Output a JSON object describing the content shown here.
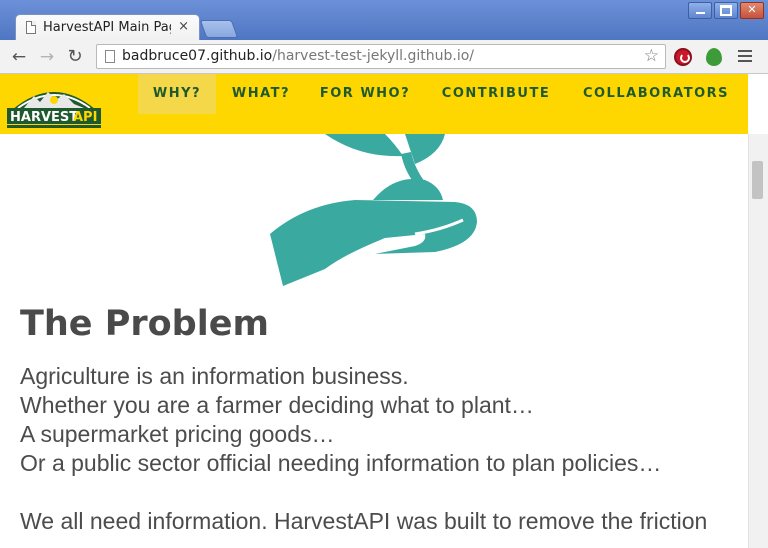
{
  "browser": {
    "tab": {
      "title": "HarvestAPI Main Pag",
      "close": "×"
    },
    "address": {
      "host": "badbruce07.github.io",
      "path": "/harvest-test-jekyll.github.io/"
    },
    "nav": {
      "back": "←",
      "forward": "→",
      "reload": "↻"
    },
    "star": "☆"
  },
  "site": {
    "logo": {
      "brand_first": "HARVEST",
      "brand_second": "API"
    },
    "nav_items": [
      {
        "label": "WHY?",
        "active": true
      },
      {
        "label": "WHAT?",
        "active": false
      },
      {
        "label": "FOR WHO?",
        "active": false
      },
      {
        "label": "CONTRIBUTE",
        "active": false
      },
      {
        "label": "COLLABORATORS",
        "active": false
      }
    ],
    "accent_color": "#ffd700",
    "hero_icon_color": "#3aaaa0"
  },
  "main": {
    "heading": "The Problem",
    "lines": [
      "Agriculture is an information business.",
      "Whether you are a farmer deciding what to plant…",
      "A supermarket pricing goods…",
      "Or a public sector official needing information to plan policies…"
    ],
    "paragraph2": "We all need information. HarvestAPI was built to remove the friction"
  }
}
